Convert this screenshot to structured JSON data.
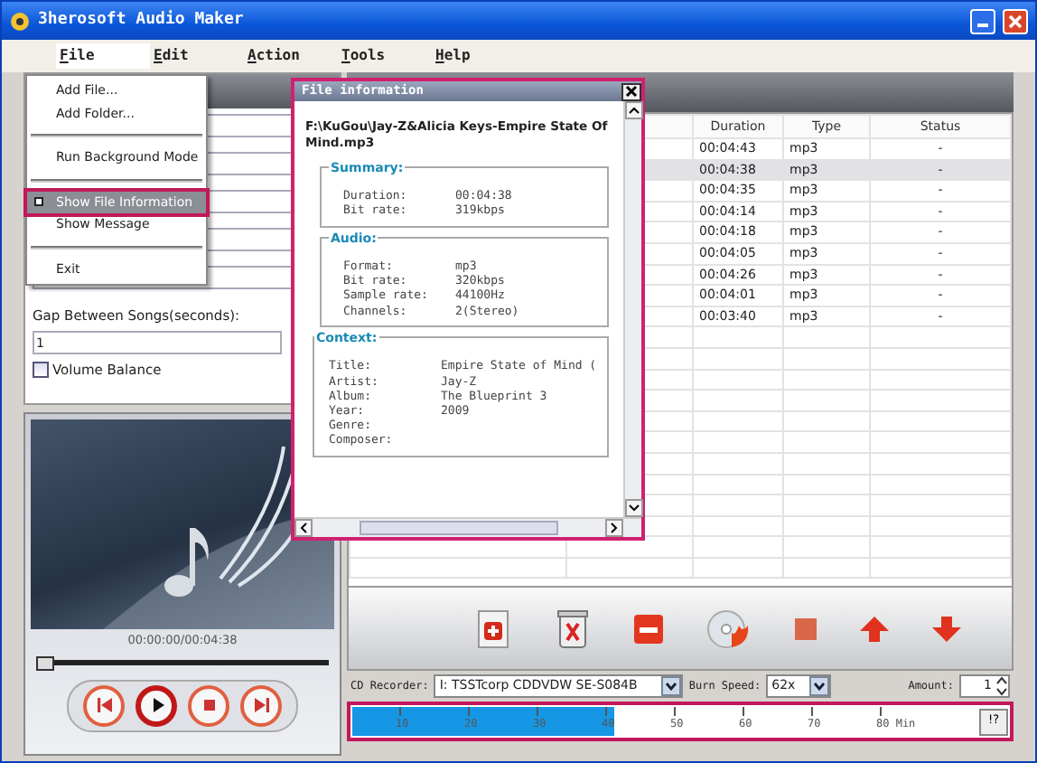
{
  "window": {
    "title": "3herosoft Audio Maker"
  },
  "menu_bar": [
    {
      "label": "File",
      "selected": true
    },
    {
      "label": "Edit",
      "selected": false
    },
    {
      "label": "Action",
      "selected": false
    },
    {
      "label": "Tools",
      "selected": false
    },
    {
      "label": "Help",
      "selected": false
    }
  ],
  "file_menu": [
    {
      "kind": "item",
      "label": "Add File...",
      "selected": false
    },
    {
      "kind": "item",
      "label": "Add Folder...",
      "selected": false
    },
    {
      "kind": "separator"
    },
    {
      "kind": "item",
      "label": "Run Background Mode",
      "selected": false
    },
    {
      "kind": "separator"
    },
    {
      "kind": "item",
      "label": "Show File Information",
      "selected": true
    },
    {
      "kind": "item",
      "label": "Show Message",
      "selected": false
    },
    {
      "kind": "separator"
    },
    {
      "kind": "item",
      "label": "Exit",
      "selected": false
    }
  ],
  "left_panel": {
    "gap_label": "Gap Between Songs(seconds):",
    "gap_value": "1",
    "volume_balance": {
      "label": "Volume Balance",
      "checked": false
    }
  },
  "player": {
    "time": "00:00:00/00:04:38",
    "level": 0
  },
  "file_info": {
    "title": "File information",
    "path": "F:\\KuGou\\Jay-Z&Alicia Keys-Empire State Of Mind.mp3",
    "sections": [
      {
        "title": "Summary:",
        "rows": [
          {
            "label": "Duration:",
            "value": "00:04:38"
          },
          {
            "label": "Bit rate:",
            "value": "319kbps"
          }
        ]
      },
      {
        "title": "Audio:",
        "rows": [
          {
            "label": "Format:",
            "value": "mp3"
          },
          {
            "label": "Bit rate:",
            "value": "320kbps"
          },
          {
            "label": "Sample rate:",
            "value": "44100Hz"
          },
          {
            "label": "Channels:",
            "value": "2(Stereo)"
          }
        ]
      },
      {
        "title": "Context:",
        "rows": [
          {
            "label": "Title:",
            "value": "Empire State of Mind ("
          },
          {
            "label": "Artist:",
            "value": "Jay-Z"
          },
          {
            "label": "Album:",
            "value": "The Blueprint 3"
          },
          {
            "label": "Year:",
            "value": "2009"
          },
          {
            "label": "Genre:",
            "value": ""
          },
          {
            "label": "Composer:",
            "value": ""
          }
        ]
      }
    ]
  },
  "table": {
    "columns": [
      "Duration",
      "Type",
      "Status"
    ],
    "rows": [
      {
        "duration": "00:04:43",
        "type": "mp3",
        "status": "-",
        "selected": false
      },
      {
        "duration": "00:04:38",
        "type": "mp3",
        "status": "-",
        "selected": true
      },
      {
        "duration": "00:04:35",
        "type": "mp3",
        "status": "-",
        "selected": false
      },
      {
        "duration": "00:04:14",
        "type": "mp3",
        "status": "-",
        "selected": false
      },
      {
        "duration": "00:04:18",
        "type": "mp3",
        "status": "-",
        "selected": false
      },
      {
        "duration": "00:04:05",
        "type": "mp3",
        "status": "-",
        "selected": false
      },
      {
        "duration": "00:04:26",
        "type": "mp3",
        "status": "-",
        "selected": false
      },
      {
        "duration": "00:04:01",
        "type": "mp3",
        "status": "-",
        "selected": false
      },
      {
        "duration": "00:03:40",
        "type": "mp3",
        "status": "-",
        "selected": false
      }
    ]
  },
  "recorder": {
    "label": "CD Recorder:",
    "device": "I: TSSTcorp CDDVDW SE-S084B",
    "speed_label": "Burn Speed:",
    "speed": "62x",
    "amount_label": "Amount:",
    "amount": "1"
  },
  "capacity": {
    "level": 0.42,
    "ticks": [
      "10",
      "20",
      "30",
      "40",
      "50",
      "60",
      "70",
      "80 Min"
    ],
    "help": "!?"
  }
}
